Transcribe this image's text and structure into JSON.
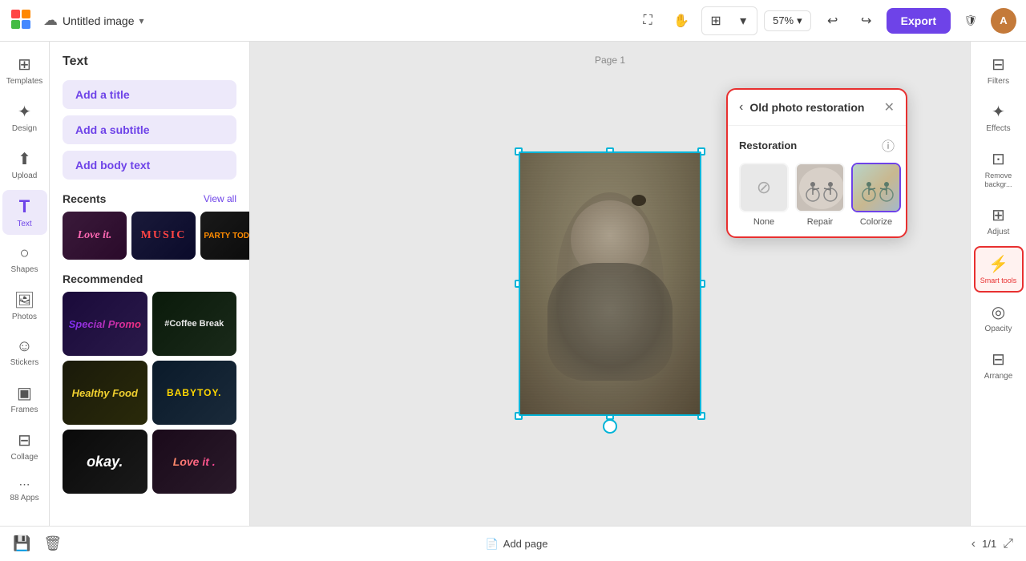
{
  "topbar": {
    "title": "Untitled image",
    "zoom": "57%",
    "export_label": "Export",
    "undo_icon": "↩",
    "redo_icon": "↪"
  },
  "sidebar": {
    "items": [
      {
        "id": "templates",
        "label": "Templates",
        "icon": "⊞"
      },
      {
        "id": "design",
        "label": "Design",
        "icon": "✦"
      },
      {
        "id": "upload",
        "label": "Upload",
        "icon": "⬆"
      },
      {
        "id": "text",
        "label": "Text",
        "icon": "T",
        "active": true
      },
      {
        "id": "shapes",
        "label": "Shapes",
        "icon": "○"
      },
      {
        "id": "photos",
        "label": "Photos",
        "icon": "🖼"
      },
      {
        "id": "stickers",
        "label": "Stickers",
        "icon": "☺"
      },
      {
        "id": "frames",
        "label": "Frames",
        "icon": "▣"
      },
      {
        "id": "collage",
        "label": "Collage",
        "icon": "⊟"
      },
      {
        "id": "apps",
        "label": "88 Apps",
        "icon": "⋯"
      }
    ]
  },
  "panel": {
    "title": "Text",
    "add_title_label": "Add a title",
    "add_subtitle_label": "Add a subtitle",
    "add_body_label": "Add body text",
    "recents_label": "Recents",
    "view_all_label": "View all",
    "recommended_label": "Recommended",
    "recents": [
      {
        "id": "love-it",
        "text": "Love it.",
        "style": "rec-love-it"
      },
      {
        "id": "music",
        "text": "MUSIC",
        "style": "rec-music"
      },
      {
        "id": "party",
        "text": "PARTY TODAY.",
        "style": "rec-party"
      }
    ],
    "recommended": [
      {
        "id": "special-promo",
        "text": "Special Promo",
        "style": "rec-special-promo"
      },
      {
        "id": "coffee-break",
        "text": "#Coffee Break",
        "style": "rec-coffee"
      },
      {
        "id": "healthy-food",
        "text": "Healthy Food",
        "style": "rec-healthy"
      },
      {
        "id": "babytoy",
        "text": "BABYTOY.",
        "style": "rec-babytoy"
      },
      {
        "id": "okay",
        "text": "okay.",
        "style": "rec-okay"
      },
      {
        "id": "love-it-2",
        "text": "Love it .",
        "style": "rec-loveit2"
      }
    ]
  },
  "canvas": {
    "page_label": "Page 1"
  },
  "floating_toolbar": {
    "buttons": [
      "⊞",
      "⊡",
      "⊕",
      "•••"
    ]
  },
  "popup": {
    "title": "Old photo restoration",
    "restoration_label": "Restoration",
    "back_icon": "‹",
    "close_icon": "✕",
    "options": [
      {
        "id": "none",
        "label": "None",
        "selected": false
      },
      {
        "id": "repair",
        "label": "Repair",
        "selected": false
      },
      {
        "id": "colorize",
        "label": "Colorize",
        "selected": true
      }
    ]
  },
  "right_panel": {
    "items": [
      {
        "id": "filters",
        "label": "Filters",
        "icon": "⊟"
      },
      {
        "id": "effects",
        "label": "Effects",
        "icon": "✦"
      },
      {
        "id": "remove-bg",
        "label": "Remove\nbackgr...",
        "icon": "⊡"
      },
      {
        "id": "adjust",
        "label": "Adjust",
        "icon": "⊞"
      },
      {
        "id": "smart-tools",
        "label": "Smart\ntools",
        "icon": "⚡",
        "active": true
      },
      {
        "id": "opacity",
        "label": "Opacity",
        "icon": "◎"
      },
      {
        "id": "arrange",
        "label": "Arrange",
        "icon": "⊟"
      }
    ]
  },
  "bottom_bar": {
    "add_page_label": "Add page",
    "page_current": "1",
    "page_total": "1/1"
  }
}
